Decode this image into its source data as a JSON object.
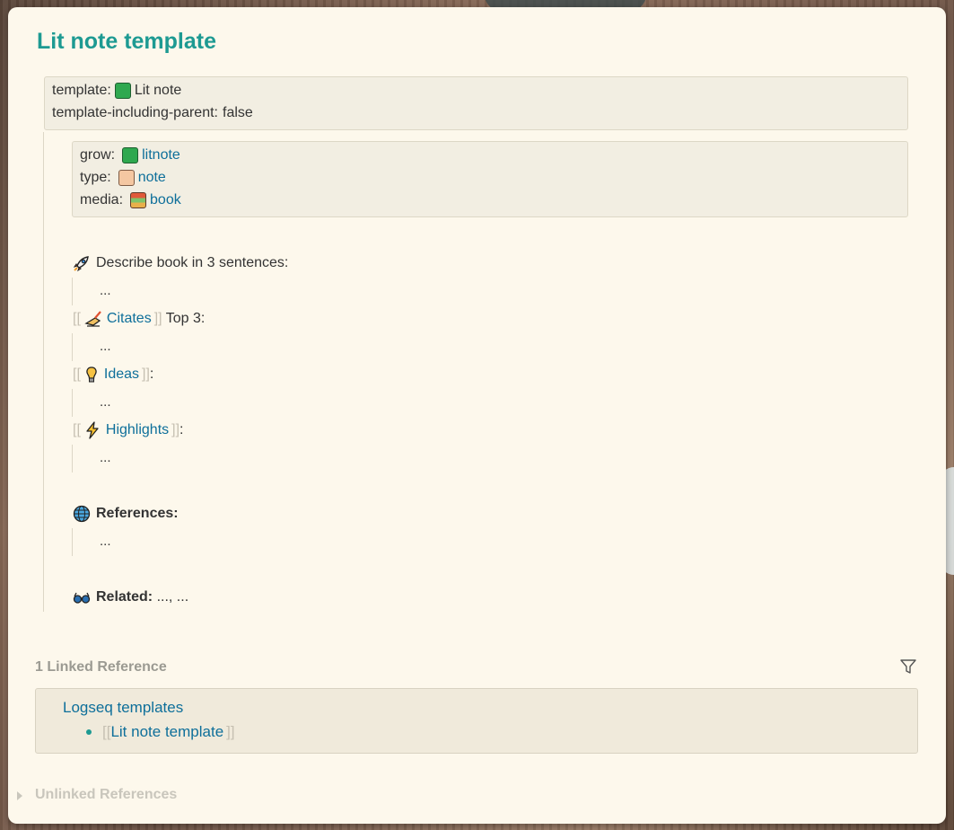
{
  "page": {
    "title": "Lit note template"
  },
  "template_props": [
    {
      "key": "template:",
      "value": "Lit note",
      "icon": "green-book-icon"
    },
    {
      "key": "template-including-parent:",
      "value": "false"
    }
  ],
  "block_props": [
    {
      "key": "grow:",
      "value": "litnote",
      "icon": "green-book-icon"
    },
    {
      "key": "type:",
      "value": "note",
      "icon": "notebook-icon"
    },
    {
      "key": "media:",
      "value": "book",
      "icon": "books-icon"
    }
  ],
  "blocks": {
    "describe": {
      "label": "Describe book in 3 sentences:",
      "child": "...",
      "icon": "rocket-icon"
    },
    "citates": {
      "open": "[[",
      "link": "Citates",
      "close": "]]",
      "suffix": " Top 3:",
      "child": "...",
      "icon": "writing-hand-icon"
    },
    "ideas": {
      "open": "[[",
      "link": "Ideas",
      "close": "]]",
      "suffix": ":",
      "child": "...",
      "icon": "lightbulb-icon"
    },
    "highlights": {
      "open": "[[",
      "link": "Highlights",
      "close": "]]",
      "suffix": ":",
      "child": "...",
      "icon": "lightning-icon"
    },
    "references": {
      "label": "References:",
      "child": "...",
      "icon": "globe-icon"
    },
    "related": {
      "label": "Related:",
      "value": " ..., ...",
      "icon": "glasses-icon"
    }
  },
  "linked_refs": {
    "title": "1 Linked Reference",
    "page": "Logseq templates",
    "item": {
      "open": "[[",
      "link": "Lit note template",
      "close": "]]"
    }
  },
  "unlinked_refs": {
    "title": "Unlinked References"
  },
  "colors": {
    "accent": "#1d9a92",
    "link": "#0e6f9a",
    "card_bg": "#fdf8ec"
  }
}
